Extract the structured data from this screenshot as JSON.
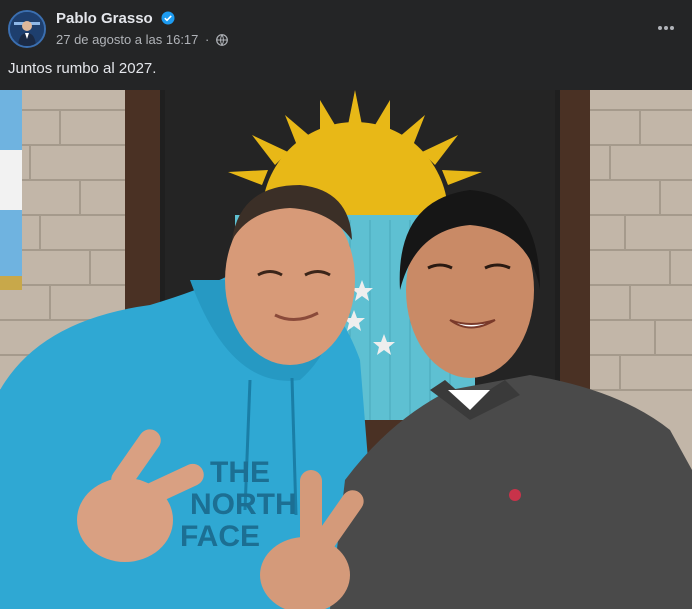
{
  "post": {
    "author": "Pablo Grasso",
    "date": "27 de agosto a las 16:17",
    "separator": "·",
    "caption": "Juntos rumbo al 2027.",
    "icons": {
      "avatar": "profile-avatar",
      "verified": "verified-badge-icon",
      "audience": "globe-icon",
      "more": "more-options-icon"
    },
    "colors": {
      "background": "#242526",
      "text": "#e4e6eb",
      "meta": "#b0b3b8",
      "verified": "#1d9bf0"
    }
  },
  "photo": {
    "printed_text": [
      "THE",
      "NORTH",
      "FACE"
    ]
  }
}
